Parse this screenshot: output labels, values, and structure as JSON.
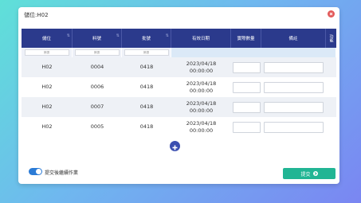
{
  "dialog": {
    "title": "儲位:H02"
  },
  "table": {
    "headers": [
      "儲位",
      "料號",
      "批號",
      "有效日期",
      "實際數量",
      "備註",
      "功能"
    ],
    "filter_placeholders": [
      "篩選",
      "篩選",
      "篩選"
    ],
    "rows": [
      {
        "location": "H02",
        "part_no": "0004",
        "batch": "0418",
        "expiry_date": "2023/04/18",
        "expiry_time": "00:00:00"
      },
      {
        "location": "H02",
        "part_no": "0006",
        "batch": "0418",
        "expiry_date": "2023/04/18",
        "expiry_time": "00:00:00"
      },
      {
        "location": "H02",
        "part_no": "0007",
        "batch": "0418",
        "expiry_date": "2023/04/18",
        "expiry_time": "00:00:00"
      },
      {
        "location": "H02",
        "part_no": "0005",
        "batch": "0418",
        "expiry_date": "2023/04/18",
        "expiry_time": "00:00:00"
      }
    ]
  },
  "footer": {
    "toggle_label": "提交後繼續作業",
    "toggle_on": true,
    "submit_label": "提交"
  },
  "colors": {
    "header_bg": "#2b3a8c",
    "submit_bg": "#21b594",
    "close_bg": "#e25a5a",
    "toggle_bg": "#2b7bd6"
  }
}
